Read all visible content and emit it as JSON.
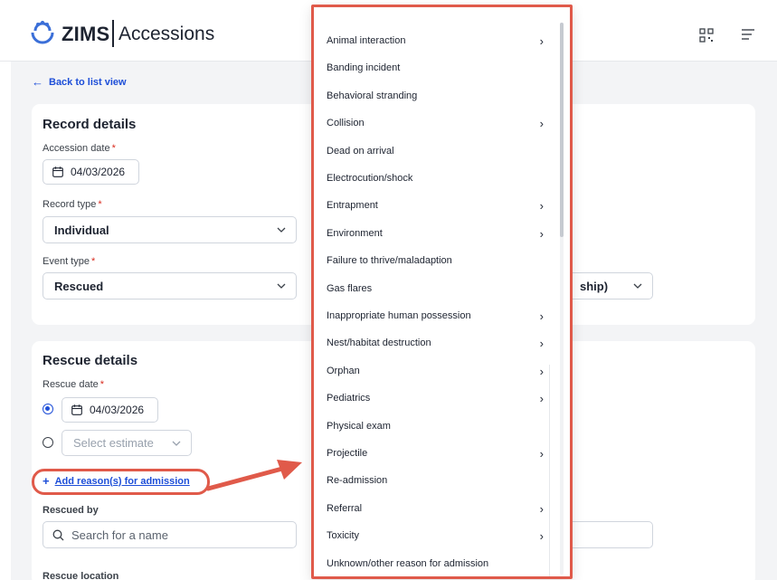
{
  "header": {
    "brand": "ZIMS",
    "module": "Accessions"
  },
  "back_link": "Back to list view",
  "record_details": {
    "title": "Record details",
    "accession_date_label": "Accession date",
    "accession_date_value": "04/03/2026",
    "record_type_label": "Record type",
    "record_type_value": "Individual",
    "event_type_label": "Event type",
    "event_type_value": "Rescued",
    "partial_select_text": "ship)"
  },
  "rescue_details": {
    "title": "Rescue details",
    "rescue_date_label": "Rescue date",
    "rescue_date_value": "04/03/2026",
    "estimate_placeholder": "Select estimate",
    "add_reasons_link": "Add reason(s) for admission",
    "rescued_by_label": "Rescued by",
    "rescued_by_placeholder": "Search for a name",
    "rescue_location_label": "Rescue location"
  },
  "reasons_dropdown": {
    "items": [
      {
        "label": "Animal interaction",
        "has_submenu": true
      },
      {
        "label": "Banding incident",
        "has_submenu": false
      },
      {
        "label": "Behavioral stranding",
        "has_submenu": false
      },
      {
        "label": "Collision",
        "has_submenu": true
      },
      {
        "label": "Dead on arrival",
        "has_submenu": false
      },
      {
        "label": "Electrocution/shock",
        "has_submenu": false
      },
      {
        "label": "Entrapment",
        "has_submenu": true
      },
      {
        "label": "Environment",
        "has_submenu": true
      },
      {
        "label": "Failure to thrive/maladaption",
        "has_submenu": false
      },
      {
        "label": "Gas flares",
        "has_submenu": false
      },
      {
        "label": "Inappropriate human possession",
        "has_submenu": true
      },
      {
        "label": "Nest/habitat destruction",
        "has_submenu": true
      },
      {
        "label": "Orphan",
        "has_submenu": true
      },
      {
        "label": "Pediatrics",
        "has_submenu": true
      },
      {
        "label": "Physical exam",
        "has_submenu": false
      },
      {
        "label": "Projectile",
        "has_submenu": true
      },
      {
        "label": "Re-admission",
        "has_submenu": false
      },
      {
        "label": "Referral",
        "has_submenu": true
      },
      {
        "label": "Toxicity",
        "has_submenu": true
      },
      {
        "label": "Unknown/other reason for admission",
        "has_submenu": false
      }
    ]
  },
  "colors": {
    "accent": "#1d4ed8",
    "highlight": "#e05a4a",
    "required": "#d92d20",
    "background": "#f3f4f6"
  }
}
